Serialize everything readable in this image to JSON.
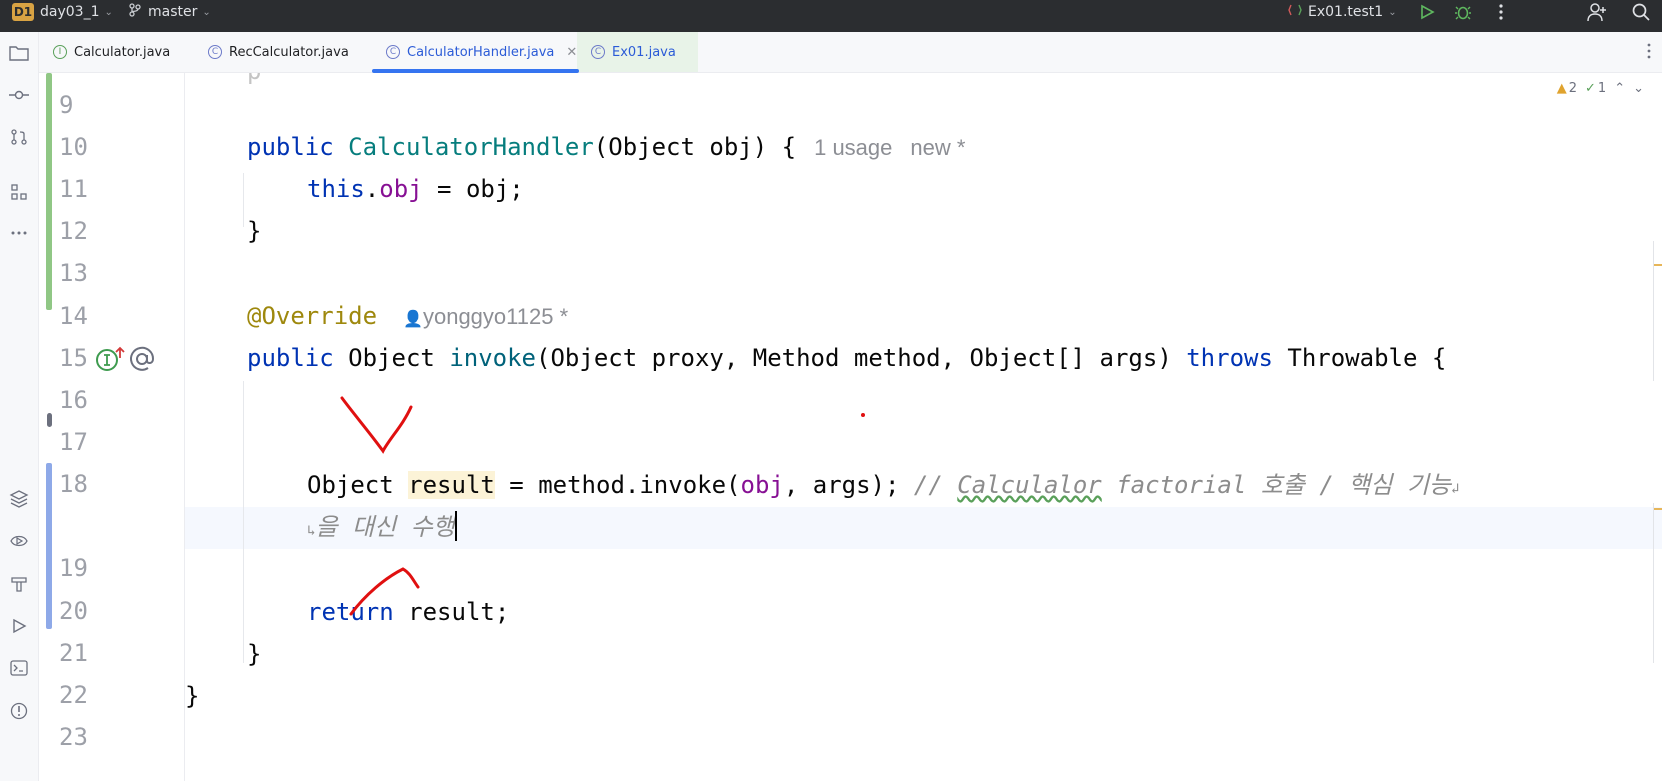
{
  "titlebar": {
    "project_badge": "D1",
    "project_name": "day03_1",
    "branch": "master",
    "run_config": "Ex01.test1"
  },
  "tabs": [
    {
      "label": "Calculator.java",
      "icon": "interface-icon"
    },
    {
      "label": "RecCalculator.java",
      "icon": "class-icon"
    },
    {
      "label": "CalculatorHandler.java",
      "icon": "class-icon",
      "active": true
    },
    {
      "label": "Ex01.java",
      "icon": "class-run-icon"
    }
  ],
  "inspections": {
    "warnings": "2",
    "weak_warnings": "1"
  },
  "line_numbers": [
    "9",
    "10",
    "11",
    "12",
    "13",
    "14",
    "15",
    "16",
    "17",
    "18",
    "19",
    "20",
    "21",
    "22",
    "23"
  ],
  "code": {
    "l10_kw": "public ",
    "l10_ctor": "CalculatorHandler",
    "l10_params": "(Object obj) {",
    "l10_hint_usage": "1 usage",
    "l10_hint_new": "new *",
    "l11_this": "this",
    "l11_dot": ".",
    "l11_field": "obj",
    "l11_rest": " = obj;",
    "l12": "}",
    "l14_ann": "@Override",
    "l14_author": "yonggyo1125 *",
    "l15_kw": "public ",
    "l15_type": "Object ",
    "l15_method": "invoke",
    "l15_params": "(Object proxy, Method method, Object[] args) ",
    "l15_throws": "throws",
    "l15_tail": " Throwable {",
    "l18_type": "Object ",
    "l18_var": "result",
    "l18_mid": " = method.invoke(",
    "l18_field": "obj",
    "l18_end": ", args); ",
    "l18_cmt_a": "// ",
    "l18_cmt_word": "Calculalor",
    "l18_cmt_b": " factorial 호출 / 핵심 기능",
    "l18_wrap": "을 대신 수행",
    "l20_kw": "return",
    "l20_rest": " result;",
    "l21": "}",
    "l22": "}"
  },
  "colors": {
    "keyword": "#0033b3",
    "field": "#871094",
    "comment": "#8c8c8c",
    "annotation": "#9e880d",
    "accent": "#3574f0"
  }
}
